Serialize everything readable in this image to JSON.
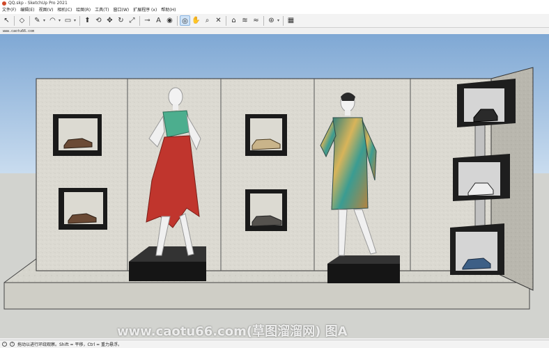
{
  "window": {
    "title": "QQ.skp - SketchUp Pro 2021"
  },
  "menu": [
    "文件(F)",
    "编辑(E)",
    "视图(V)",
    "相机(C)",
    "绘图(R)",
    "工具(T)",
    "窗口(W)",
    "扩展程序 (x)",
    "帮助(H)"
  ],
  "toolbar": {
    "icons": [
      {
        "name": "select-icon",
        "glyph": "↖"
      },
      {
        "name": "eraser-icon",
        "glyph": "◇"
      },
      {
        "name": "pencil-icon",
        "glyph": "✎"
      },
      {
        "name": "arc-icon",
        "glyph": "◠"
      },
      {
        "name": "rectangle-icon",
        "glyph": "▭"
      },
      {
        "name": "push-pull-icon",
        "glyph": "⬆"
      },
      {
        "name": "follow-me-icon",
        "glyph": "⟲"
      },
      {
        "name": "move-icon",
        "glyph": "✥"
      },
      {
        "name": "rotate-icon",
        "glyph": "↻"
      },
      {
        "name": "scale-icon",
        "glyph": "⤢"
      },
      {
        "name": "tape-measure-icon",
        "glyph": "⊸"
      },
      {
        "name": "text-icon",
        "glyph": "A"
      },
      {
        "name": "paint-bucket-icon",
        "glyph": "◉"
      },
      {
        "name": "orbit-icon",
        "glyph": "◎"
      },
      {
        "name": "pan-icon",
        "glyph": "✋"
      },
      {
        "name": "zoom-icon",
        "glyph": "⌕"
      },
      {
        "name": "zoom-extents-icon",
        "glyph": "✕"
      },
      {
        "name": "warehouse-icon",
        "glyph": "⌂"
      },
      {
        "name": "extension-warehouse-icon",
        "glyph": "≋"
      },
      {
        "name": "layout-icon",
        "glyph": "≈"
      },
      {
        "name": "styles-icon",
        "glyph": "⊛"
      },
      {
        "name": "sandbox-icon",
        "glyph": "▦"
      }
    ]
  },
  "overlay_url": "www.caotu66.com",
  "watermark": "www.caotu66.com(草图溜溜网) 图A",
  "status": {
    "text": "拖动以进行环绕观察。Shift = 平移，Ctrl = 重力悬浮。"
  },
  "colors": {
    "sky": "#a9c7e6",
    "ground": "#d4d4cc",
    "wall": "#dcdad2",
    "box": "#1a1a1a",
    "skirt": "#c0352d",
    "top": "#4cae8e"
  }
}
